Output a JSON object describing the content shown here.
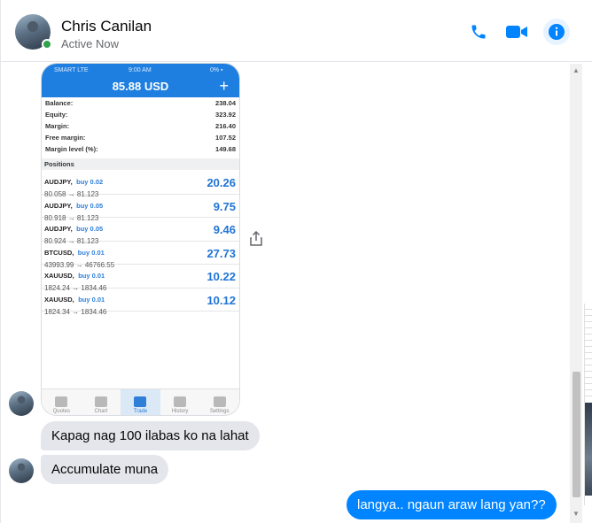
{
  "header": {
    "contact_name": "Chris Canilan",
    "status": "Active Now",
    "accent_color": "#0084ff",
    "online_color": "#31a24c",
    "icons": [
      "phone-icon",
      "video-camera-icon",
      "info-icon"
    ]
  },
  "screenshot": {
    "status_bar": {
      "carrier": "SMART LTE",
      "time": "9:00 AM",
      "battery": "0% ▪"
    },
    "balance_title": "85.88 USD",
    "plus": "+",
    "account": [
      {
        "label": "Balance:",
        "value": "238.04"
      },
      {
        "label": "Equity:",
        "value": "323.92"
      },
      {
        "label": "Margin:",
        "value": "216.40"
      },
      {
        "label": "Free margin:",
        "value": "107.52"
      },
      {
        "label": "Margin level (%):",
        "value": "149.68"
      }
    ],
    "positions_label": "Positions",
    "positions": [
      {
        "symbol": "AUDJPY,",
        "side": "buy 0.02",
        "prices": "80.058 → 81.123",
        "profit": "20.26"
      },
      {
        "symbol": "AUDJPY,",
        "side": "buy 0.05",
        "prices": "80.918 → 81.123",
        "profit": "9.75"
      },
      {
        "symbol": "AUDJPY,",
        "side": "buy 0.05",
        "prices": "80.924 → 81.123",
        "profit": "9.46"
      },
      {
        "symbol": "BTCUSD,",
        "side": "buy 0.01",
        "prices": "43993.99 → 46766.55",
        "profit": "27.73"
      },
      {
        "symbol": "XAUUSD,",
        "side": "buy 0.01",
        "prices": "1824.24 → 1834.46",
        "profit": "10.22"
      },
      {
        "symbol": "XAUUSD,",
        "side": "buy 0.01",
        "prices": "1824.34 → 1834.46",
        "profit": "10.12"
      }
    ],
    "tabs": [
      "Quotes",
      "Chart",
      "Trade",
      "History",
      "Settings"
    ],
    "active_tab": "Trade"
  },
  "messages": {
    "incoming_1": "Kapag nag 100 ilabas ko na lahat",
    "incoming_2": "Accumulate muna",
    "outgoing_1": "langya.. ngaun araw lang yan??"
  }
}
